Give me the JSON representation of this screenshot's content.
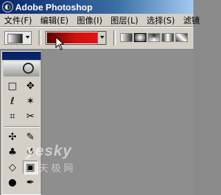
{
  "window": {
    "title": "Adobe Photoshop"
  },
  "menubar": {
    "items": [
      {
        "label": "文件(F)"
      },
      {
        "label": "编辑(E)"
      },
      {
        "label": "图像(I)"
      },
      {
        "label": "图层(L)"
      },
      {
        "label": "选择(S)"
      },
      {
        "label": "滤镜"
      }
    ]
  },
  "options": {
    "gradient_colors": [
      "#5a0000",
      "#e01414"
    ],
    "gradient_types": [
      "linear",
      "radial",
      "angle",
      "reflected",
      "diamond"
    ]
  },
  "watermark": {
    "brand": "yesky",
    "cn": "天极网"
  },
  "tools": {
    "marquee": "□",
    "move": "✥",
    "lasso": "ℓ",
    "magic": "✶",
    "crop": "⌗",
    "slice": "✂",
    "heal": "✣",
    "brush": "✎",
    "stamp": "♣",
    "history": "↺",
    "eraser": "◇",
    "bucket": "▣",
    "dodge": "●",
    "path": "◆",
    "pen": "✒"
  }
}
